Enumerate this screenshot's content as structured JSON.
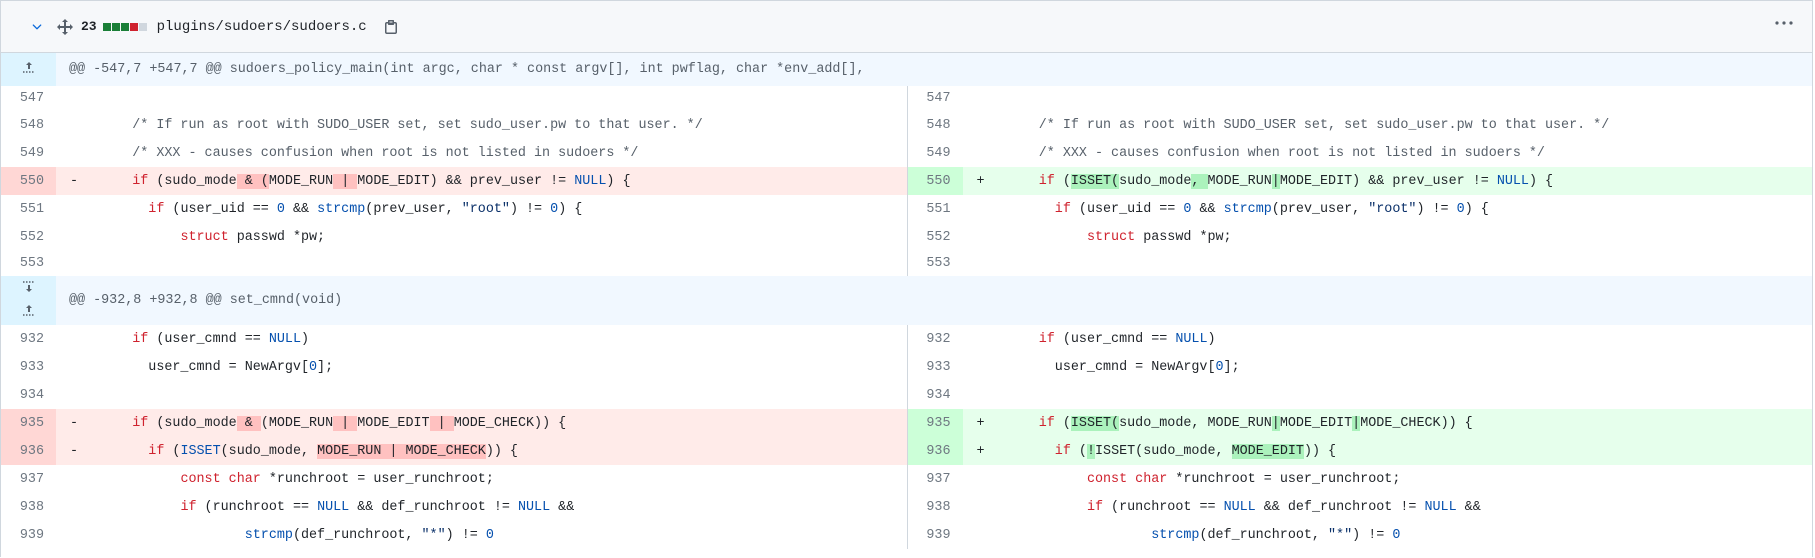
{
  "header": {
    "changes": "23",
    "file_path": "plugins/sudoers/sudoers.c",
    "blocks": [
      "#1a7f37",
      "#1a7f37",
      "#1a7f37",
      "#cf222e",
      "#d0d7de"
    ]
  },
  "hunks": [
    {
      "header": "@@ -547,7 +547,7 @@ sudoers_policy_main(int argc, char * const argv[], int pwflag, char *env_add[],",
      "rows": [
        {
          "l": "547",
          "r": "547",
          "type": "ctx",
          "left": [],
          "right": []
        },
        {
          "l": "548",
          "r": "548",
          "type": "ctx",
          "left": [
            [
              "      ",
              ""
            ],
            [
              "/* If run as root with SUDO_USER set, set sudo_user.pw to that user. */",
              "cm"
            ]
          ],
          "right": [
            [
              "      ",
              ""
            ],
            [
              "/* If run as root with SUDO_USER set, set sudo_user.pw to that user. */",
              "cm"
            ]
          ]
        },
        {
          "l": "549",
          "r": "549",
          "type": "ctx",
          "left": [
            [
              "      ",
              ""
            ],
            [
              "/* XXX - causes confusion when root is not listed in sudoers */",
              "cm"
            ]
          ],
          "right": [
            [
              "      ",
              ""
            ],
            [
              "/* XXX - causes confusion when root is not listed in sudoers */",
              "cm"
            ]
          ]
        },
        {
          "l": "550",
          "r": "550",
          "type": "chg",
          "left": [
            [
              "      ",
              ""
            ],
            [
              "if",
              "kw"
            ],
            [
              " (sudo_mode",
              ""
            ],
            [
              " & (",
              "hl-del"
            ],
            [
              "MODE_RUN",
              ""
            ],
            [
              " | ",
              "hl-del"
            ],
            [
              "MODE_EDIT) && prev_user != ",
              ""
            ],
            [
              "NULL",
              "num"
            ],
            [
              ") {",
              ""
            ]
          ],
          "right": [
            [
              "      ",
              ""
            ],
            [
              "if",
              "kw"
            ],
            [
              " (",
              ""
            ],
            [
              "ISSET(",
              "hl-add"
            ],
            [
              "sudo_mode",
              ""
            ],
            [
              ", ",
              "hl-add"
            ],
            [
              "MODE_RUN",
              ""
            ],
            [
              "|",
              "hl-add"
            ],
            [
              "MODE_EDIT) && prev_user != ",
              ""
            ],
            [
              "NULL",
              "num"
            ],
            [
              ") {",
              ""
            ]
          ]
        },
        {
          "l": "551",
          "r": "551",
          "type": "ctx",
          "left": [
            [
              "        ",
              ""
            ],
            [
              "if",
              "kw"
            ],
            [
              " (user_uid == ",
              ""
            ],
            [
              "0",
              "num"
            ],
            [
              " && ",
              ""
            ],
            [
              "strcmp",
              "fn"
            ],
            [
              "(prev_user, ",
              ""
            ],
            [
              "\"root\"",
              "str"
            ],
            [
              ") != ",
              ""
            ],
            [
              "0",
              "num"
            ],
            [
              ") {",
              ""
            ]
          ],
          "right": [
            [
              "        ",
              ""
            ],
            [
              "if",
              "kw"
            ],
            [
              " (user_uid == ",
              ""
            ],
            [
              "0",
              "num"
            ],
            [
              " && ",
              ""
            ],
            [
              "strcmp",
              "fn"
            ],
            [
              "(prev_user, ",
              ""
            ],
            [
              "\"root\"",
              "str"
            ],
            [
              ") != ",
              ""
            ],
            [
              "0",
              "num"
            ],
            [
              ") {",
              ""
            ]
          ]
        },
        {
          "l": "552",
          "r": "552",
          "type": "ctx",
          "left": [
            [
              "            ",
              ""
            ],
            [
              "struct",
              "kw"
            ],
            [
              " passwd *pw;",
              ""
            ]
          ],
          "right": [
            [
              "            ",
              ""
            ],
            [
              "struct",
              "kw"
            ],
            [
              " passwd *pw;",
              ""
            ]
          ]
        },
        {
          "l": "553",
          "r": "553",
          "type": "ctx",
          "left": [],
          "right": []
        }
      ]
    },
    {
      "header": "@@ -932,8 +932,8 @@ set_cmnd(void)",
      "rows": [
        {
          "l": "932",
          "r": "932",
          "type": "ctx",
          "left": [
            [
              "      ",
              ""
            ],
            [
              "if",
              "kw"
            ],
            [
              " (user_cmnd == ",
              ""
            ],
            [
              "NULL",
              "num"
            ],
            [
              ")",
              ""
            ]
          ],
          "right": [
            [
              "      ",
              ""
            ],
            [
              "if",
              "kw"
            ],
            [
              " (user_cmnd == ",
              ""
            ],
            [
              "NULL",
              "num"
            ],
            [
              ")",
              ""
            ]
          ]
        },
        {
          "l": "933",
          "r": "933",
          "type": "ctx",
          "left": [
            [
              "        user_cmnd = NewArgv[",
              ""
            ],
            [
              "0",
              "num"
            ],
            [
              "];",
              ""
            ]
          ],
          "right": [
            [
              "        user_cmnd = NewArgv[",
              ""
            ],
            [
              "0",
              "num"
            ],
            [
              "];",
              ""
            ]
          ]
        },
        {
          "l": "934",
          "r": "934",
          "type": "ctx",
          "left": [],
          "right": []
        },
        {
          "l": "935",
          "r": "935",
          "type": "chg",
          "left": [
            [
              "      ",
              ""
            ],
            [
              "if",
              "kw"
            ],
            [
              " (sudo_mode",
              ""
            ],
            [
              " & ",
              "hl-del"
            ],
            [
              "(MODE_RUN",
              ""
            ],
            [
              " | ",
              "hl-del"
            ],
            [
              "MODE_EDIT",
              ""
            ],
            [
              " | ",
              "hl-del"
            ],
            [
              "MODE_CHECK)) {",
              ""
            ]
          ],
          "right": [
            [
              "      ",
              ""
            ],
            [
              "if",
              "kw"
            ],
            [
              " (",
              ""
            ],
            [
              "ISSET(",
              "hl-add"
            ],
            [
              "sudo_mode, ",
              ""
            ],
            [
              "MODE_RUN",
              ""
            ],
            [
              "|",
              "hl-add"
            ],
            [
              "MODE_EDIT",
              ""
            ],
            [
              "|",
              "hl-add"
            ],
            [
              "MODE_CHECK)) {",
              ""
            ]
          ]
        },
        {
          "l": "936",
          "r": "936",
          "type": "chg",
          "left": [
            [
              "        ",
              ""
            ],
            [
              "if",
              "kw"
            ],
            [
              " (",
              ""
            ],
            [
              "ISSET",
              "fn"
            ],
            [
              "(sudo_mode, ",
              ""
            ],
            [
              "MODE_RUN | MODE_CHECK",
              "hl-del"
            ],
            [
              ")) {",
              ""
            ]
          ],
          "right": [
            [
              "        ",
              ""
            ],
            [
              "if",
              "kw"
            ],
            [
              " (",
              ""
            ],
            [
              "!",
              "hl-add"
            ],
            [
              "ISSET(sudo_mode, ",
              ""
            ],
            [
              "MODE_EDIT",
              "hl-add"
            ],
            [
              ")) {",
              ""
            ]
          ]
        },
        {
          "l": "937",
          "r": "937",
          "type": "ctx",
          "left": [
            [
              "            ",
              ""
            ],
            [
              "const",
              "kw"
            ],
            [
              " ",
              ""
            ],
            [
              "char",
              "kw"
            ],
            [
              " *runchroot = user_runchroot;",
              ""
            ]
          ],
          "right": [
            [
              "            ",
              ""
            ],
            [
              "const",
              "kw"
            ],
            [
              " ",
              ""
            ],
            [
              "char",
              "kw"
            ],
            [
              " *runchroot = user_runchroot;",
              ""
            ]
          ]
        },
        {
          "l": "938",
          "r": "938",
          "type": "ctx",
          "left": [
            [
              "            ",
              ""
            ],
            [
              "if",
              "kw"
            ],
            [
              " (runchroot == ",
              ""
            ],
            [
              "NULL",
              "num"
            ],
            [
              " && def_runchroot != ",
              ""
            ],
            [
              "NULL",
              "num"
            ],
            [
              " &&",
              ""
            ]
          ],
          "right": [
            [
              "            ",
              ""
            ],
            [
              "if",
              "kw"
            ],
            [
              " (runchroot == ",
              ""
            ],
            [
              "NULL",
              "num"
            ],
            [
              " && def_runchroot != ",
              ""
            ],
            [
              "NULL",
              "num"
            ],
            [
              " &&",
              ""
            ]
          ]
        },
        {
          "l": "939",
          "r": "939",
          "type": "ctx",
          "left": [
            [
              "                    ",
              ""
            ],
            [
              "strcmp",
              "fn"
            ],
            [
              "(def_runchroot, ",
              ""
            ],
            [
              "\"*\"",
              "str"
            ],
            [
              ") != ",
              ""
            ],
            [
              "0",
              "num"
            ],
            [
              "",
              ""
            ]
          ],
          "right": [
            [
              "                    ",
              ""
            ],
            [
              "strcmp",
              "fn"
            ],
            [
              "(def_runchroot, ",
              ""
            ],
            [
              "\"*\"",
              "str"
            ],
            [
              ") != ",
              ""
            ],
            [
              "0",
              "num"
            ],
            [
              "",
              ""
            ]
          ]
        }
      ]
    }
  ],
  "markers": {
    "del": "-",
    "add": "+"
  }
}
